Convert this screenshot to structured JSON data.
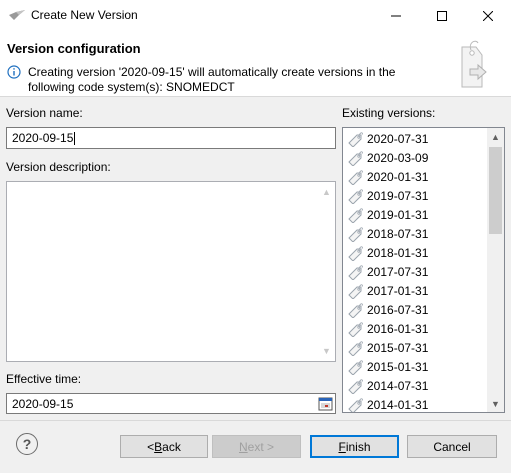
{
  "window": {
    "title": "Create New Version",
    "minimize_glyph": "—",
    "maximize_glyph": "☐",
    "close_glyph": "✕"
  },
  "header": {
    "title": "Version configuration",
    "message": "Creating version '2020-09-15' will automatically create versions in the following code system(s): SNOMEDCT"
  },
  "form": {
    "version_name_label": "Version name:",
    "version_name_value": "2020-09-15",
    "description_label": "Version description:",
    "effective_time_label": "Effective time:",
    "effective_time_value": "2020-09-15"
  },
  "existing_versions": {
    "label": "Existing versions:",
    "items": [
      "2020-07-31",
      "2020-03-09",
      "2020-01-31",
      "2019-07-31",
      "2019-01-31",
      "2018-07-31",
      "2018-01-31",
      "2017-07-31",
      "2017-01-31",
      "2016-07-31",
      "2016-01-31",
      "2015-07-31",
      "2015-01-31",
      "2014-07-31",
      "2014-01-31"
    ]
  },
  "buttons": {
    "back_prefix": "< ",
    "back_mnemonic": "B",
    "back_rest": "ack",
    "next_mnemonic": "N",
    "next_rest": "ext >",
    "finish_mnemonic": "F",
    "finish_rest": "inish",
    "cancel": "Cancel",
    "help": "?"
  },
  "colors": {
    "accent": "#0078d7",
    "info_icon": "#1e6fbf"
  }
}
